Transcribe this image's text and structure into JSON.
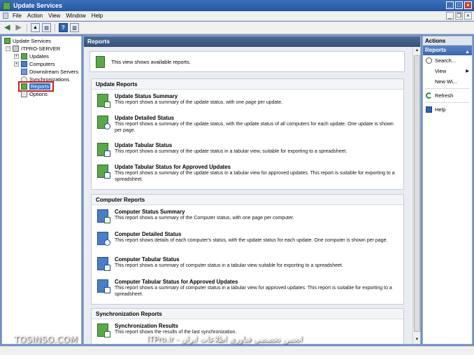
{
  "window": {
    "title": "Update Services"
  },
  "menu": {
    "items": [
      "File",
      "Action",
      "View",
      "Window",
      "Help"
    ]
  },
  "tree": {
    "root": "Update Services",
    "server": "ITPRO-SERVER",
    "children": [
      "Updates",
      "Computers",
      "Downstream Servers",
      "Synchronizations",
      "Reports",
      "Options"
    ]
  },
  "center": {
    "header": "Reports",
    "intro": "This view shows available reports.",
    "sections": [
      {
        "title": "Update Reports",
        "reports": [
          {
            "title": "Update Status Summary",
            "desc": "This report shows a summary of the update status, with one page per update."
          },
          {
            "title": "Update Detailed Status",
            "desc": "This report shows a summary of the update status, with the update status of all computers for each update. One update is shown per page."
          },
          {
            "title": "Update Tabular Status",
            "desc": "This report shows a summary of the update status in a tabular view, suitable for exporting to a spreadsheet."
          },
          {
            "title": "Update Tabular Status for Approved Updates",
            "desc": "This report shows a summary of the update status in a tabular view for approved updates. This report is suitable for exporting to a spreadsheet."
          }
        ]
      },
      {
        "title": "Computer Reports",
        "reports": [
          {
            "title": "Computer Status Summary",
            "desc": "This report shows a summary of the Computer status, with one page per computer."
          },
          {
            "title": "Computer Detailed Status",
            "desc": "This report shows details of each computer's status, with the update status for each update. One computer is shown per page."
          },
          {
            "title": "Computer Tabular Status",
            "desc": "This report shows a summary of computer status in a tabular view suitable for exporting to a spreadsheet."
          },
          {
            "title": "Computer Tabular Status for Approved Updates",
            "desc": "This report shows a summary of computer status in a tabular view for approved updates. This report is suitable for exporting to a spreadsheet."
          }
        ]
      },
      {
        "title": "Synchronization Reports",
        "reports": [
          {
            "title": "Synchronization Results",
            "desc": "This report shows the results of the last synchronization."
          }
        ]
      }
    ]
  },
  "actions": {
    "header": "Actions",
    "subheader": "Reports",
    "items": [
      "Search...",
      "View",
      "New Wi...",
      "Refresh",
      "Help"
    ]
  },
  "watermarks": {
    "left": "TOSINSO.COM",
    "right": "ITPro.ir - انجمن تخصصی فناوری اطلاعات ایران"
  }
}
